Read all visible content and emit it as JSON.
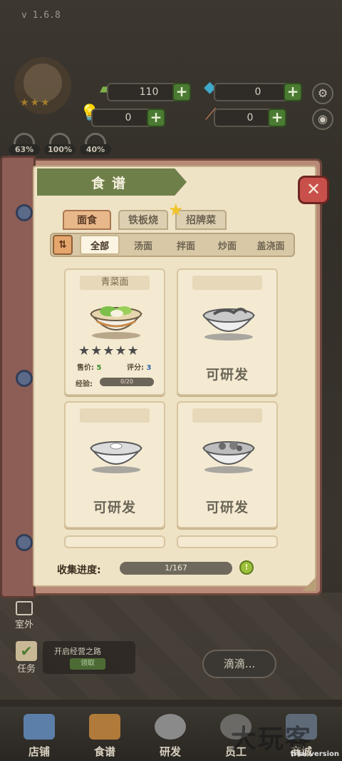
{
  "app": {
    "version": "v 1.6.8",
    "trial": "trial version"
  },
  "hud": {
    "coins": "110",
    "gems": "0",
    "ideas": "0",
    "chopsticks": "0",
    "stats": [
      "63%",
      "100%",
      "40%"
    ]
  },
  "book": {
    "title": "食谱",
    "tabs": [
      {
        "label": "面食",
        "active": true
      },
      {
        "label": "铁板烧",
        "active": false
      },
      {
        "label": "招牌菜",
        "active": false
      }
    ],
    "sort_label": "⇅",
    "subtabs": [
      {
        "label": "全部",
        "active": true
      },
      {
        "label": "汤面",
        "active": false
      },
      {
        "label": "拌面",
        "active": false
      },
      {
        "label": "炒面",
        "active": false
      },
      {
        "label": "盖浇面",
        "active": false
      }
    ],
    "cards": [
      {
        "name": "青菜面",
        "unlocked": true,
        "stars": "★★★★★",
        "price_label": "售价:",
        "price": "5",
        "score_label": "评分:",
        "score": "3",
        "xp_label": "经验:",
        "xp": "0/20"
      },
      {
        "name": "",
        "unlocked": false,
        "status": "可研发"
      },
      {
        "name": "",
        "unlocked": false,
        "status": "可研发"
      },
      {
        "name": "",
        "unlocked": false,
        "status": "可研发"
      }
    ],
    "progress_label": "收集进度:",
    "progress": "1/167",
    "progress_icon": "!"
  },
  "lower": {
    "outdoor": "室外",
    "task_label": "任务",
    "task_text": "开启经营之路",
    "task_btn": "领取",
    "bubble": "滴滴..."
  },
  "nav": [
    "店铺",
    "食谱",
    "研发",
    "员工",
    "商城"
  ],
  "watermark": "大玩客",
  "colors": {
    "accent_green": "#6f7f4a",
    "close_red": "#c9504a",
    "page": "#efe3c6",
    "tab_active": "#e9b88a"
  }
}
